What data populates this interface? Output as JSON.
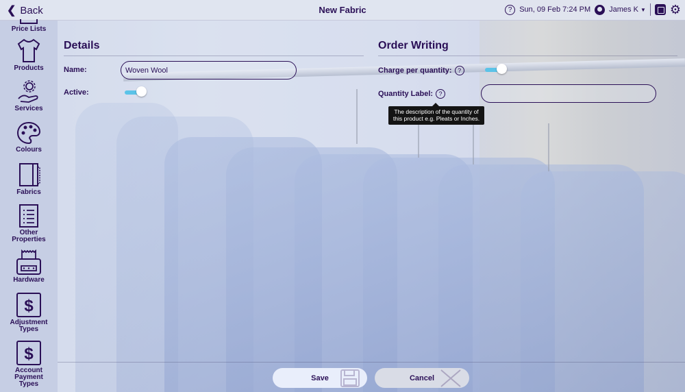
{
  "topbar": {
    "back_label": "Back",
    "title": "New Fabric",
    "datetime": "Sun, 09 Feb 7:24 PM",
    "user_name": "James K"
  },
  "sidebar": {
    "items": [
      {
        "label": "Price Lists",
        "icon": "price-list-icon"
      },
      {
        "label": "Products",
        "icon": "tshirt-icon"
      },
      {
        "label": "Services",
        "icon": "hand-gear-icon"
      },
      {
        "label": "Colours",
        "icon": "palette-icon"
      },
      {
        "label": "Fabrics",
        "icon": "fabric-icon"
      },
      {
        "label": "Other Properties",
        "icon": "list-icon"
      },
      {
        "label": "Hardware",
        "icon": "printer-icon"
      },
      {
        "label": "Adjustment Types",
        "icon": "dollar-icon"
      },
      {
        "label": "Account Payment Types",
        "icon": "dollar-icon"
      }
    ]
  },
  "details": {
    "heading": "Details",
    "name_label": "Name:",
    "name_value": "Woven Wool",
    "active_label": "Active:",
    "active": true
  },
  "order_writing": {
    "heading": "Order Writing",
    "charge_label": "Charge per quantity:",
    "charge_enabled": true,
    "quantity_label": "Quantity Label:",
    "quantity_value": "",
    "tooltip_line1": "The description of the quantity of",
    "tooltip_line2": "this product e.g. Pleats or Inches."
  },
  "footer": {
    "save_label": "Save",
    "cancel_label": "Cancel"
  },
  "colors": {
    "text": "#2a0f56",
    "toggle_on": "#5bc3e8",
    "tooltip_bg": "#141414"
  }
}
